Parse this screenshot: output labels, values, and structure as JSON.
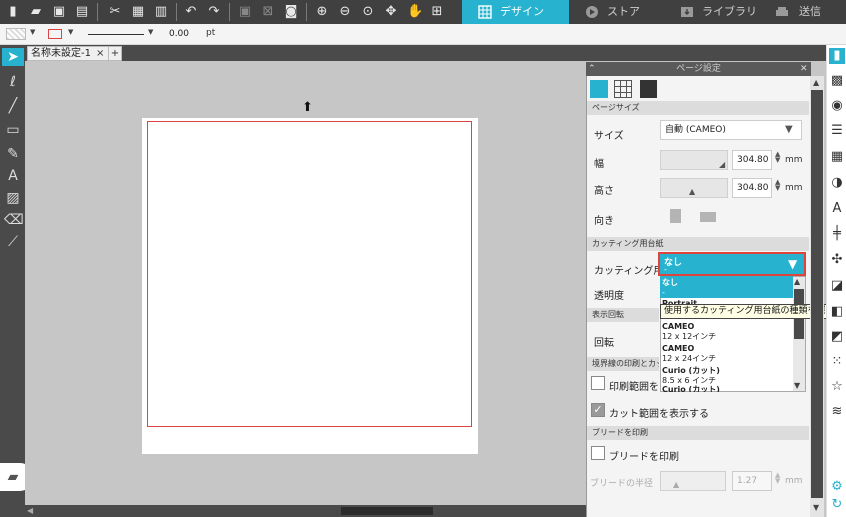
{
  "toolbar": {
    "icons": [
      "new-icon",
      "open-icon",
      "save-icon",
      "print-icon",
      "cut-icon",
      "copy-icon",
      "paste-icon",
      "undo-icon",
      "redo-icon",
      "group-icon",
      "ungroup-icon",
      "compound-icon",
      "zoom-in-icon",
      "zoom-out-icon",
      "zoom-fit-icon",
      "move-icon",
      "pan-icon",
      "fit-page-icon"
    ],
    "tabs": [
      {
        "label": "デザイン",
        "active": true,
        "icon": "grid-icon"
      },
      {
        "label": "ストア",
        "active": false,
        "icon": "store-icon"
      },
      {
        "label": "ライブラリ",
        "active": false,
        "icon": "library-icon"
      },
      {
        "label": "送信",
        "active": false,
        "icon": "send-icon"
      }
    ]
  },
  "propbar": {
    "line_value": "0.00",
    "line_unit": "pt"
  },
  "doc": {
    "tab_label": "名称未設定-1",
    "close": "×",
    "add": "+"
  },
  "panel": {
    "title": "ページ設定",
    "close": "✕",
    "sec_page_size": "ページサイズ",
    "size_label": "サイズ",
    "size_value": "自動 (CAMEO)",
    "width_label": "幅",
    "width_value": "304.80",
    "height_label": "高さ",
    "height_value": "304.80",
    "unit_mm": "mm",
    "orientation_label": "向き",
    "sec_cutting_mat": "カッティング用台紙",
    "mat_label": "カッティング用台",
    "mat_value": "なし",
    "mat_value_sub": "-",
    "transparency_label": "透明度",
    "sec_rotation": "表示回転",
    "rotation_label": "回転",
    "sec_border": "境界線の印刷とカット",
    "print_range_label": "印刷範囲を表",
    "show_cut_label": "カット範囲を表示する",
    "sec_bleed": "ブリードを印刷",
    "bleed_label": "ブリードを印刷",
    "bleed_width_label": "ブリードの半径",
    "bleed_width_value": "1.27",
    "tooltip": "使用するカッティング用台紙の種類を選択します。",
    "dropdown_items": [
      {
        "main": "なし",
        "sub": "-",
        "selected": true
      },
      {
        "main": "Portrait",
        "sub": "",
        "selected": false
      },
      {
        "main": "CAMEO",
        "sub": "12 x 12インチ",
        "selected": false
      },
      {
        "main": "CAMEO",
        "sub": "12 x 24インチ",
        "selected": false
      },
      {
        "main": "Curio (カット)",
        "sub": "8.5 x 6 インチ",
        "selected": false
      },
      {
        "main": "Curio (カット)",
        "sub": "",
        "selected": false
      }
    ]
  },
  "colors": {
    "accent": "#27b2cf",
    "toolbar": "#404040",
    "canvas": "#c6c6c6",
    "cut_line": "#d44444"
  }
}
